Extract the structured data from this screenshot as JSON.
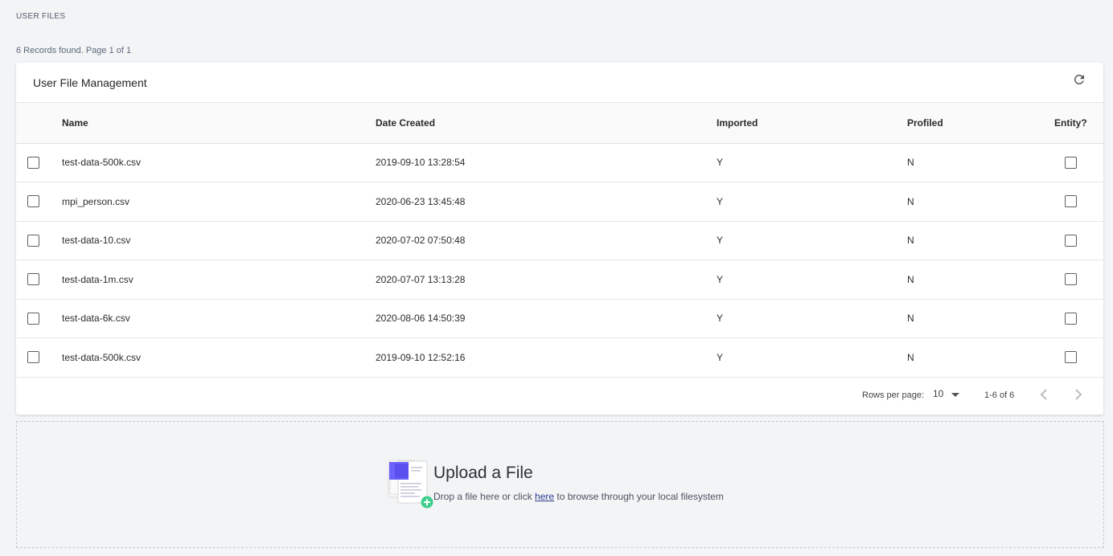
{
  "page": {
    "title": "USER FILES",
    "records_summary": "6 Records found. Page 1 of 1"
  },
  "card": {
    "title": "User File Management",
    "refresh_icon": "refresh-icon"
  },
  "table": {
    "columns": {
      "name": "Name",
      "date_created": "Date Created",
      "imported": "Imported",
      "profiled": "Profiled",
      "entity": "Entity?"
    },
    "rows": [
      {
        "name": "test-data-500k.csv",
        "date_created": "2019-09-10 13:28:54",
        "imported": "Y",
        "profiled": "N"
      },
      {
        "name": "mpi_person.csv",
        "date_created": "2020-06-23 13:45:48",
        "imported": "Y",
        "profiled": "N"
      },
      {
        "name": "test-data-10.csv",
        "date_created": "2020-07-02 07:50:48",
        "imported": "Y",
        "profiled": "N"
      },
      {
        "name": "test-data-1m.csv",
        "date_created": "2020-07-07 13:13:28",
        "imported": "Y",
        "profiled": "N"
      },
      {
        "name": "test-data-6k.csv",
        "date_created": "2020-08-06 14:50:39",
        "imported": "Y",
        "profiled": "N"
      },
      {
        "name": "test-data-500k.csv",
        "date_created": "2019-09-10 12:52:16",
        "imported": "Y",
        "profiled": "N"
      }
    ]
  },
  "pagination": {
    "rows_per_page_label": "Rows per page:",
    "rows_per_page_value": "10",
    "range": "1-6 of 6"
  },
  "upload": {
    "title": "Upload a File",
    "text_before": "Drop a file here or click ",
    "link": "here",
    "text_after": " to browse through your local filesystem"
  },
  "colors": {
    "accent_purple": "#6c63ff",
    "accent_green": "#3ecf8e"
  }
}
